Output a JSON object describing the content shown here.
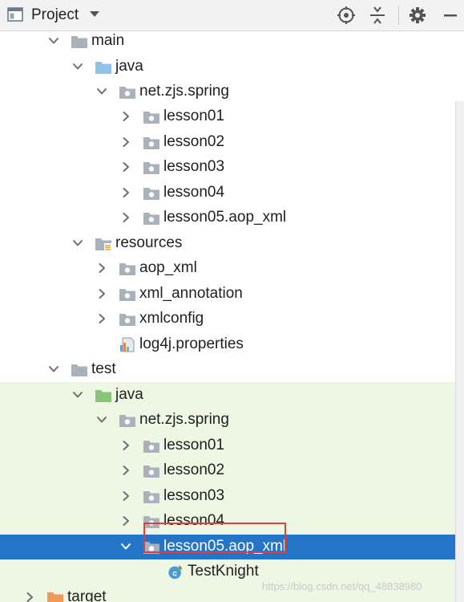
{
  "header": {
    "title": "Project",
    "icons": [
      "project-view-icon",
      "dropdown-arrow-icon",
      "locate-icon",
      "collapse-all-icon",
      "settings-icon",
      "minimize-icon"
    ]
  },
  "tree": {
    "rows": [
      {
        "label": "main",
        "icon": "folder-icon",
        "expanded": true
      },
      {
        "label": "java",
        "icon": "source-folder-icon",
        "expanded": true
      },
      {
        "label": "net.zjs.spring",
        "icon": "package-icon",
        "expanded": true
      },
      {
        "label": "lesson01",
        "icon": "package-icon",
        "expanded": false
      },
      {
        "label": "lesson02",
        "icon": "package-icon",
        "expanded": false
      },
      {
        "label": "lesson03",
        "icon": "package-icon",
        "expanded": false
      },
      {
        "label": "lesson04",
        "icon": "package-icon",
        "expanded": false
      },
      {
        "label": "lesson05.aop_xml",
        "icon": "package-icon",
        "expanded": false
      },
      {
        "label": "resources",
        "icon": "resources-folder-icon",
        "expanded": true
      },
      {
        "label": "aop_xml",
        "icon": "package-icon",
        "expanded": false
      },
      {
        "label": "xml_annotation",
        "icon": "package-icon",
        "expanded": false
      },
      {
        "label": "xmlconfig",
        "icon": "package-icon",
        "expanded": false
      },
      {
        "label": "log4j.properties",
        "icon": "properties-file-icon"
      },
      {
        "label": "test",
        "icon": "folder-icon",
        "expanded": true
      },
      {
        "label": "java",
        "icon": "test-source-folder-icon",
        "expanded": true
      },
      {
        "label": "net.zjs.spring",
        "icon": "package-icon",
        "expanded": true
      },
      {
        "label": "lesson01",
        "icon": "package-icon",
        "expanded": false
      },
      {
        "label": "lesson02",
        "icon": "package-icon",
        "expanded": false
      },
      {
        "label": "lesson03",
        "icon": "package-icon",
        "expanded": false
      },
      {
        "label": "lesson04",
        "icon": "package-icon",
        "expanded": false
      },
      {
        "label": "lesson05.aop_xml",
        "icon": "package-icon",
        "expanded": true,
        "selected": true
      },
      {
        "label": "TestKnight",
        "icon": "java-class-icon"
      },
      {
        "label": "target",
        "icon": "excluded-folder-icon",
        "expanded": false
      }
    ]
  },
  "watermark": "https://blog.csdn.net/qq_48838980",
  "colors": {
    "selection": "#2474c7",
    "test_background": "#eef7e4",
    "highlight_box": "#e0403a",
    "source_folder": "#8fc3e6",
    "test_folder": "#8ac37a",
    "excluded_folder": "#f09a5a"
  }
}
